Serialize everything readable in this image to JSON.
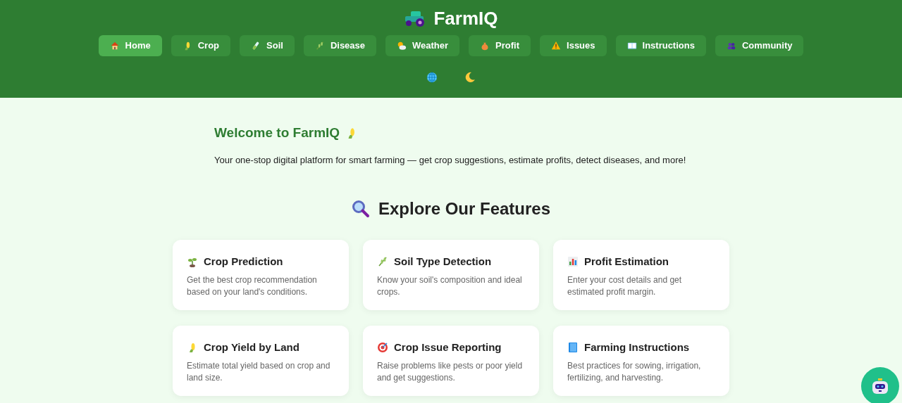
{
  "header": {
    "title": "FarmIQ"
  },
  "nav": [
    {
      "label": "Home",
      "selected": true
    },
    {
      "label": "Crop",
      "selected": false
    },
    {
      "label": "Soil",
      "selected": false
    },
    {
      "label": "Disease",
      "selected": false
    },
    {
      "label": "Weather",
      "selected": false
    },
    {
      "label": "Profit",
      "selected": false
    },
    {
      "label": "Issues",
      "selected": false
    },
    {
      "label": "Instructions",
      "selected": false
    },
    {
      "label": "Community",
      "selected": false
    }
  ],
  "welcome": {
    "title": "Welcome to FarmIQ",
    "text": "Your one-stop digital platform for smart farming — get crop suggestions, estimate profits, detect diseases, and more!"
  },
  "features": {
    "title": "Explore Our Features",
    "cards": [
      {
        "title": "Crop Prediction",
        "text": "Get the best crop recommendation based on your land's conditions."
      },
      {
        "title": "Soil Type Detection",
        "text": "Know your soil's composition and ideal crops."
      },
      {
        "title": "Profit Estimation",
        "text": "Enter your cost details and get estimated profit margin."
      },
      {
        "title": "Crop Yield by Land",
        "text": "Estimate total yield based on crop and land size."
      },
      {
        "title": "Crop Issue Reporting",
        "text": "Raise problems like pests or poor yield and get suggestions."
      },
      {
        "title": "Farming Instructions",
        "text": "Best practices for sowing, irrigation, fertilizing, and harvesting."
      }
    ]
  }
}
